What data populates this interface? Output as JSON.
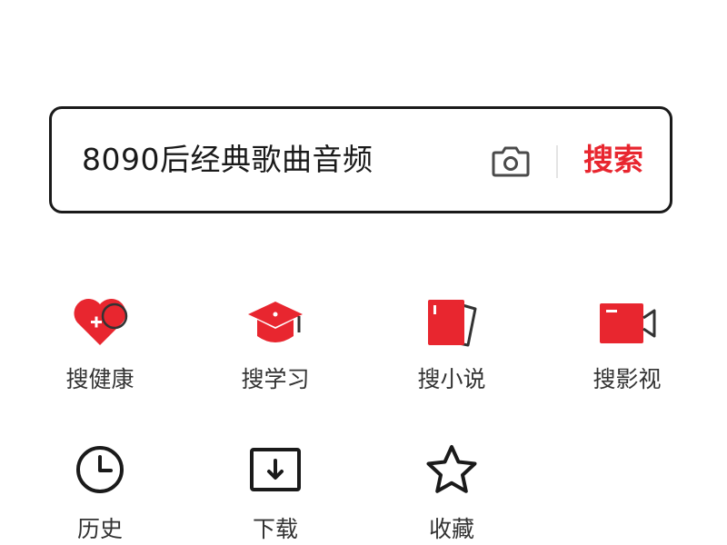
{
  "search": {
    "query": "8090后经典歌曲音频",
    "submit_label": "搜索",
    "camera_icon": "camera-icon"
  },
  "categories": [
    {
      "label": "搜健康",
      "icon": "health-heart-icon"
    },
    {
      "label": "搜学习",
      "icon": "graduation-cap-icon"
    },
    {
      "label": "搜小说",
      "icon": "book-icon"
    },
    {
      "label": "搜影视",
      "icon": "video-camera-icon"
    }
  ],
  "tools": [
    {
      "label": "历史",
      "icon": "clock-icon"
    },
    {
      "label": "下载",
      "icon": "download-icon"
    },
    {
      "label": "收藏",
      "icon": "star-icon"
    }
  ],
  "colors": {
    "accent": "#e8262f",
    "text": "#333333",
    "border": "#1a1a1a"
  }
}
